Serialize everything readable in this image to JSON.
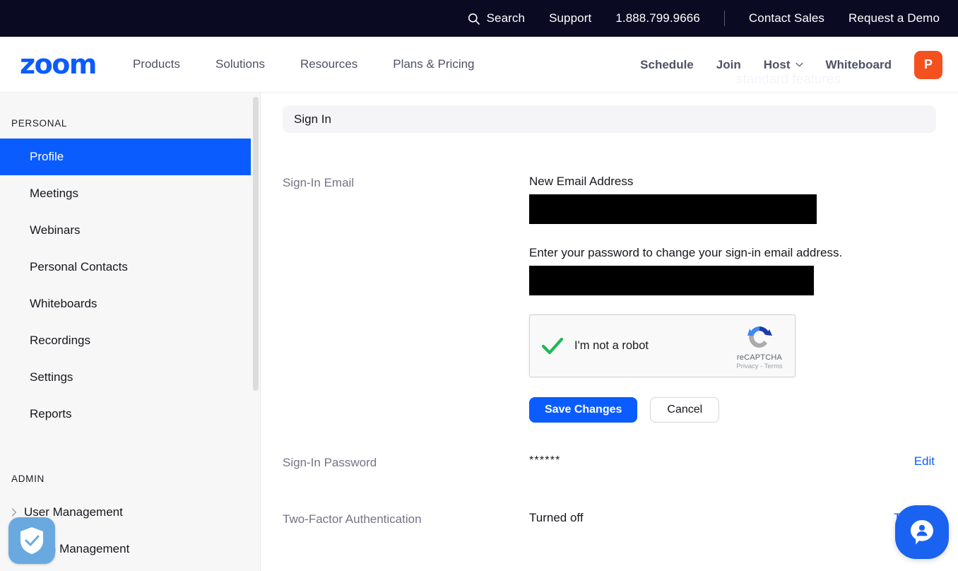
{
  "topbar": {
    "search_label": "Search",
    "items": [
      "Support",
      "1.888.799.9666"
    ],
    "right_items": [
      "Contact Sales",
      "Request a Demo"
    ]
  },
  "nav": {
    "logo_text": "zoom",
    "links": [
      "Products",
      "Solutions",
      "Resources",
      "Plans & Pricing"
    ],
    "actions": [
      "Schedule",
      "Join",
      "Host",
      "Whiteboard"
    ],
    "avatar_initial": "P",
    "avatar_color": "#f4511e",
    "ghost_text": "standard features",
    "accent_color": "#0b5cff"
  },
  "sidebar": {
    "section_personal": "PERSONAL",
    "section_admin": "ADMIN",
    "personal_items": [
      {
        "label": "Profile",
        "active": true
      },
      {
        "label": "Meetings",
        "active": false
      },
      {
        "label": "Webinars",
        "active": false
      },
      {
        "label": "Personal Contacts",
        "active": false
      },
      {
        "label": "Whiteboards",
        "active": false
      },
      {
        "label": "Recordings",
        "active": false
      },
      {
        "label": "Settings",
        "active": false
      },
      {
        "label": "Reports",
        "active": false
      }
    ],
    "admin_items": [
      {
        "label": "User Management"
      },
      {
        "label": "Room Management"
      }
    ],
    "active_color": "#0b5cff"
  },
  "main": {
    "panel_title": "Sign In",
    "sign_in_email": {
      "label": "Sign-In Email",
      "new_email_label": "New Email Address",
      "new_email_value": "",
      "password_prompt": "Enter your password to change your sign-in email address.",
      "password_value": "",
      "recaptcha": {
        "checkbox_label": "I'm not a robot",
        "brand": "reCAPTCHA",
        "legal": "Privacy - Terms",
        "checked": true
      },
      "save_label": "Save Changes",
      "cancel_label": "Cancel"
    },
    "sign_in_password": {
      "label": "Sign-In Password",
      "value": "******",
      "action": "Edit"
    },
    "two_factor": {
      "label": "Two-Factor Authentication",
      "value": "Turned off",
      "action": "Turn on"
    }
  },
  "widgets": {
    "shield_badge_name": "security-shield-badge",
    "chat_button_name": "support-chat-button"
  }
}
